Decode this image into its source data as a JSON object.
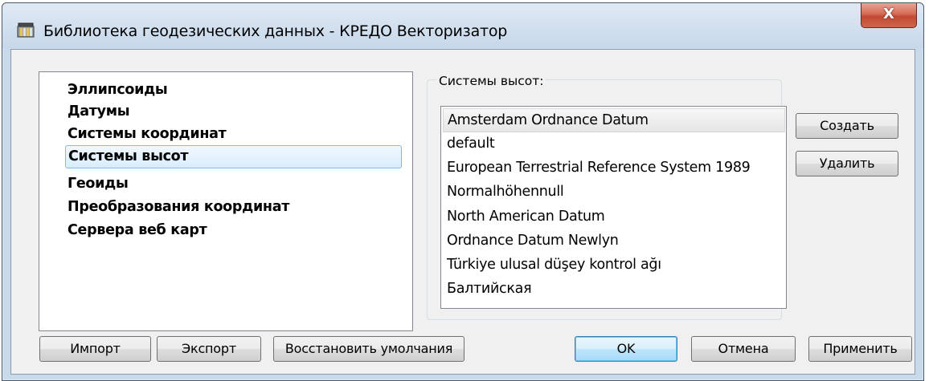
{
  "window": {
    "title": "Библиотека геодезических данных - КРЕДО Векторизатор",
    "close_label": "X"
  },
  "tree": {
    "items": [
      {
        "label": "Эллипсоиды",
        "selected": false
      },
      {
        "label": "Датумы",
        "selected": false
      },
      {
        "label": "Системы координат",
        "selected": false
      },
      {
        "label": "Системы высот",
        "selected": true
      },
      {
        "label": "Геоиды",
        "selected": false
      },
      {
        "label": "Преобразования координат",
        "selected": false
      },
      {
        "label": "Сервера веб карт",
        "selected": false
      }
    ]
  },
  "group": {
    "label": "Системы высот:",
    "items": [
      {
        "label": "Amsterdam Ordnance Datum",
        "selected": true
      },
      {
        "label": "default",
        "selected": false
      },
      {
        "label": "European Terrestrial Reference System 1989",
        "selected": false
      },
      {
        "label": "Normalhöhennull",
        "selected": false
      },
      {
        "label": "North American Datum",
        "selected": false
      },
      {
        "label": "Ordnance Datum Newlyn",
        "selected": false
      },
      {
        "label": "Türkiye ulusal düşey kontrol ağı",
        "selected": false
      },
      {
        "label": "Балтийская",
        "selected": false
      }
    ],
    "create_label": "Создать",
    "delete_label": "Удалить"
  },
  "footer": {
    "import_label": "Импорт",
    "export_label": "Экспорт",
    "restore_label": "Восстановить умолчания",
    "ok_label": "OK",
    "cancel_label": "Отмена",
    "apply_label": "Применить"
  },
  "colors": {
    "selection_border": "#86b8e3",
    "default_button_border": "#3c7fb1",
    "close_button": "#c24a33"
  }
}
